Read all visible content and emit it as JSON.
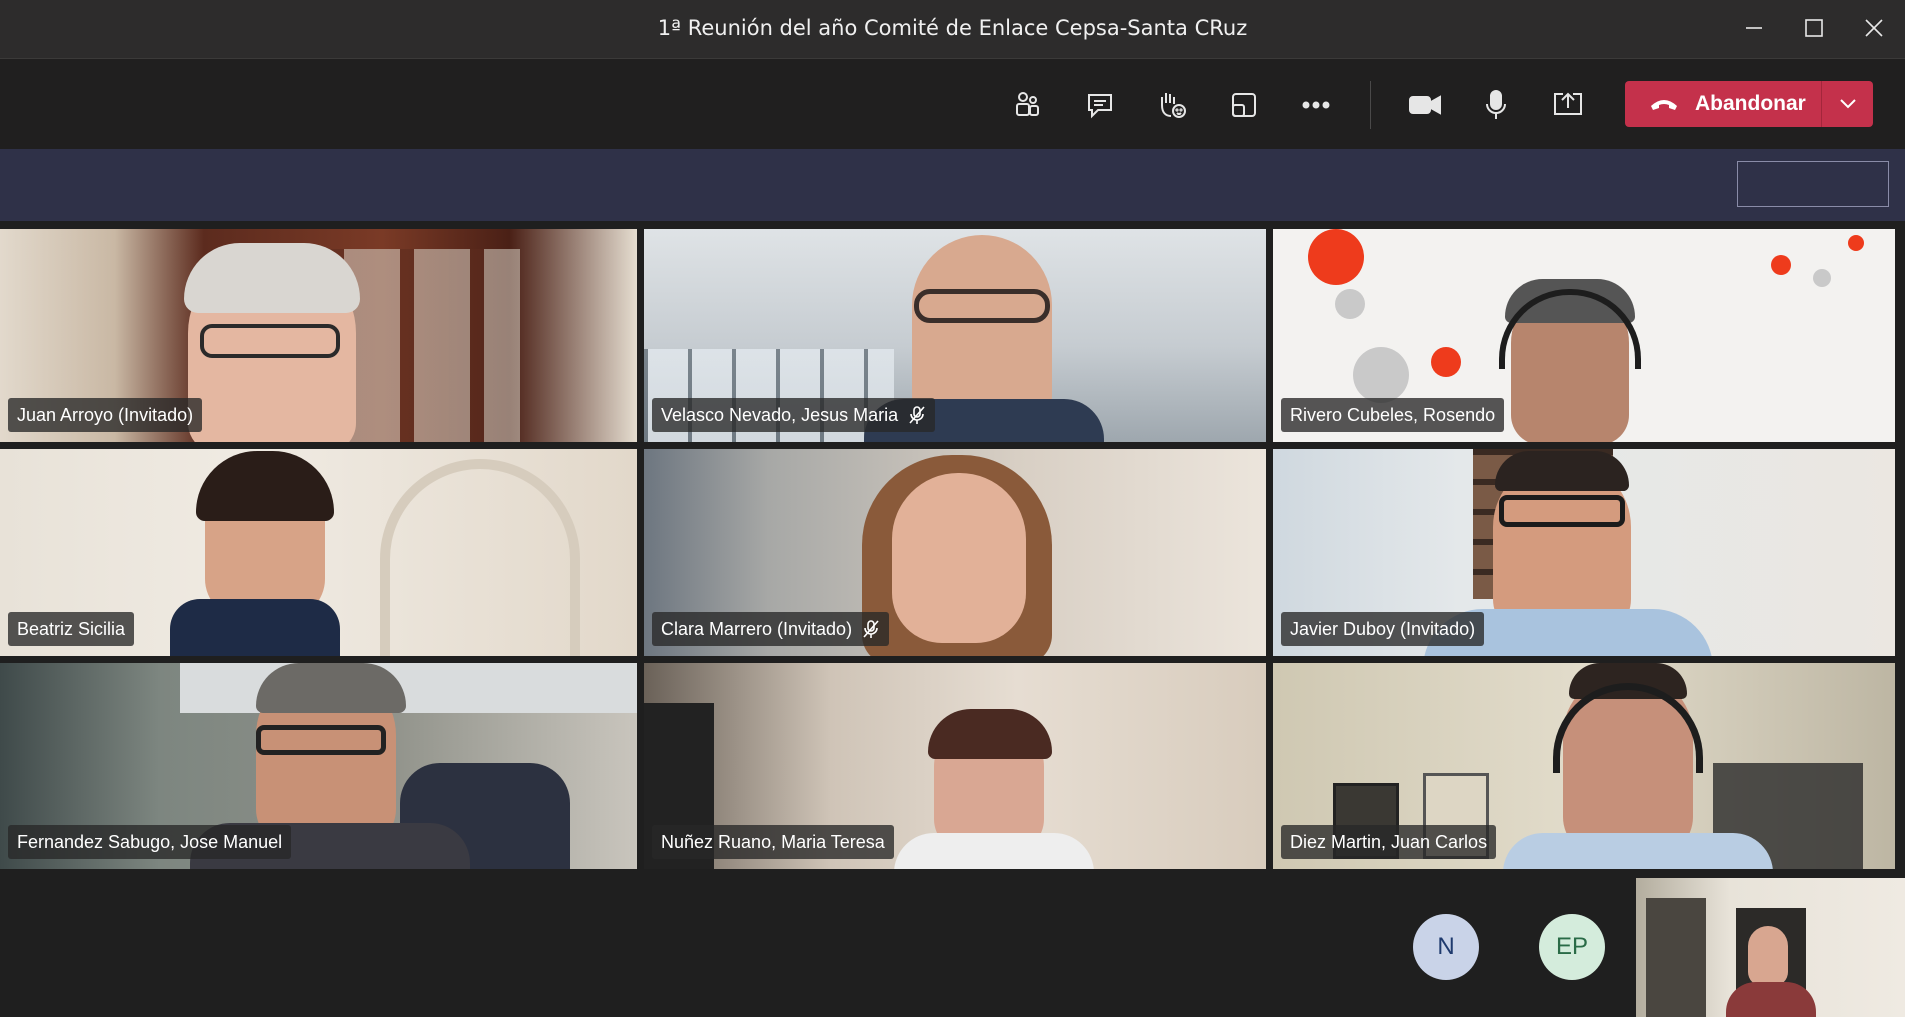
{
  "window": {
    "title": "1ª Reunión del año Comité de Enlace Cepsa-Santa CRuz"
  },
  "toolbar": {
    "participants_icon": "people-icon",
    "chat_icon": "chat-icon",
    "reactions_icon": "raise-hand-icon",
    "rooms_icon": "breakout-rooms-icon",
    "more_icon": "more-icon",
    "camera_icon": "camera-icon",
    "mic_icon": "microphone-icon",
    "share_icon": "share-screen-icon",
    "leave_label": "Abandonar",
    "leave_color": "#c4314b"
  },
  "participants": [
    {
      "name": "Juan Arroyo (Invitado)",
      "muted": false
    },
    {
      "name": "Velasco Nevado, Jesus Maria",
      "muted": true
    },
    {
      "name": "Rivero Cubeles, Rosendo",
      "muted": false
    },
    {
      "name": "Beatriz Sicilia",
      "muted": false
    },
    {
      "name": "Clara Marrero (Invitado)",
      "muted": true
    },
    {
      "name": "Javier Duboy (Invitado)",
      "muted": false
    },
    {
      "name": "Fernandez Sabugo, Jose Manuel",
      "muted": false
    },
    {
      "name": "Nuñez Ruano, Maria Teresa",
      "muted": false
    },
    {
      "name": "Diez Martin, Juan Carlos",
      "muted": false
    }
  ],
  "overflow_avatars": [
    {
      "initials": "N",
      "bg": "#c9d3e8",
      "fg": "#1f3a6e"
    },
    {
      "initials": "EP",
      "bg": "#d4ecdc",
      "fg": "#2a6b47"
    }
  ]
}
